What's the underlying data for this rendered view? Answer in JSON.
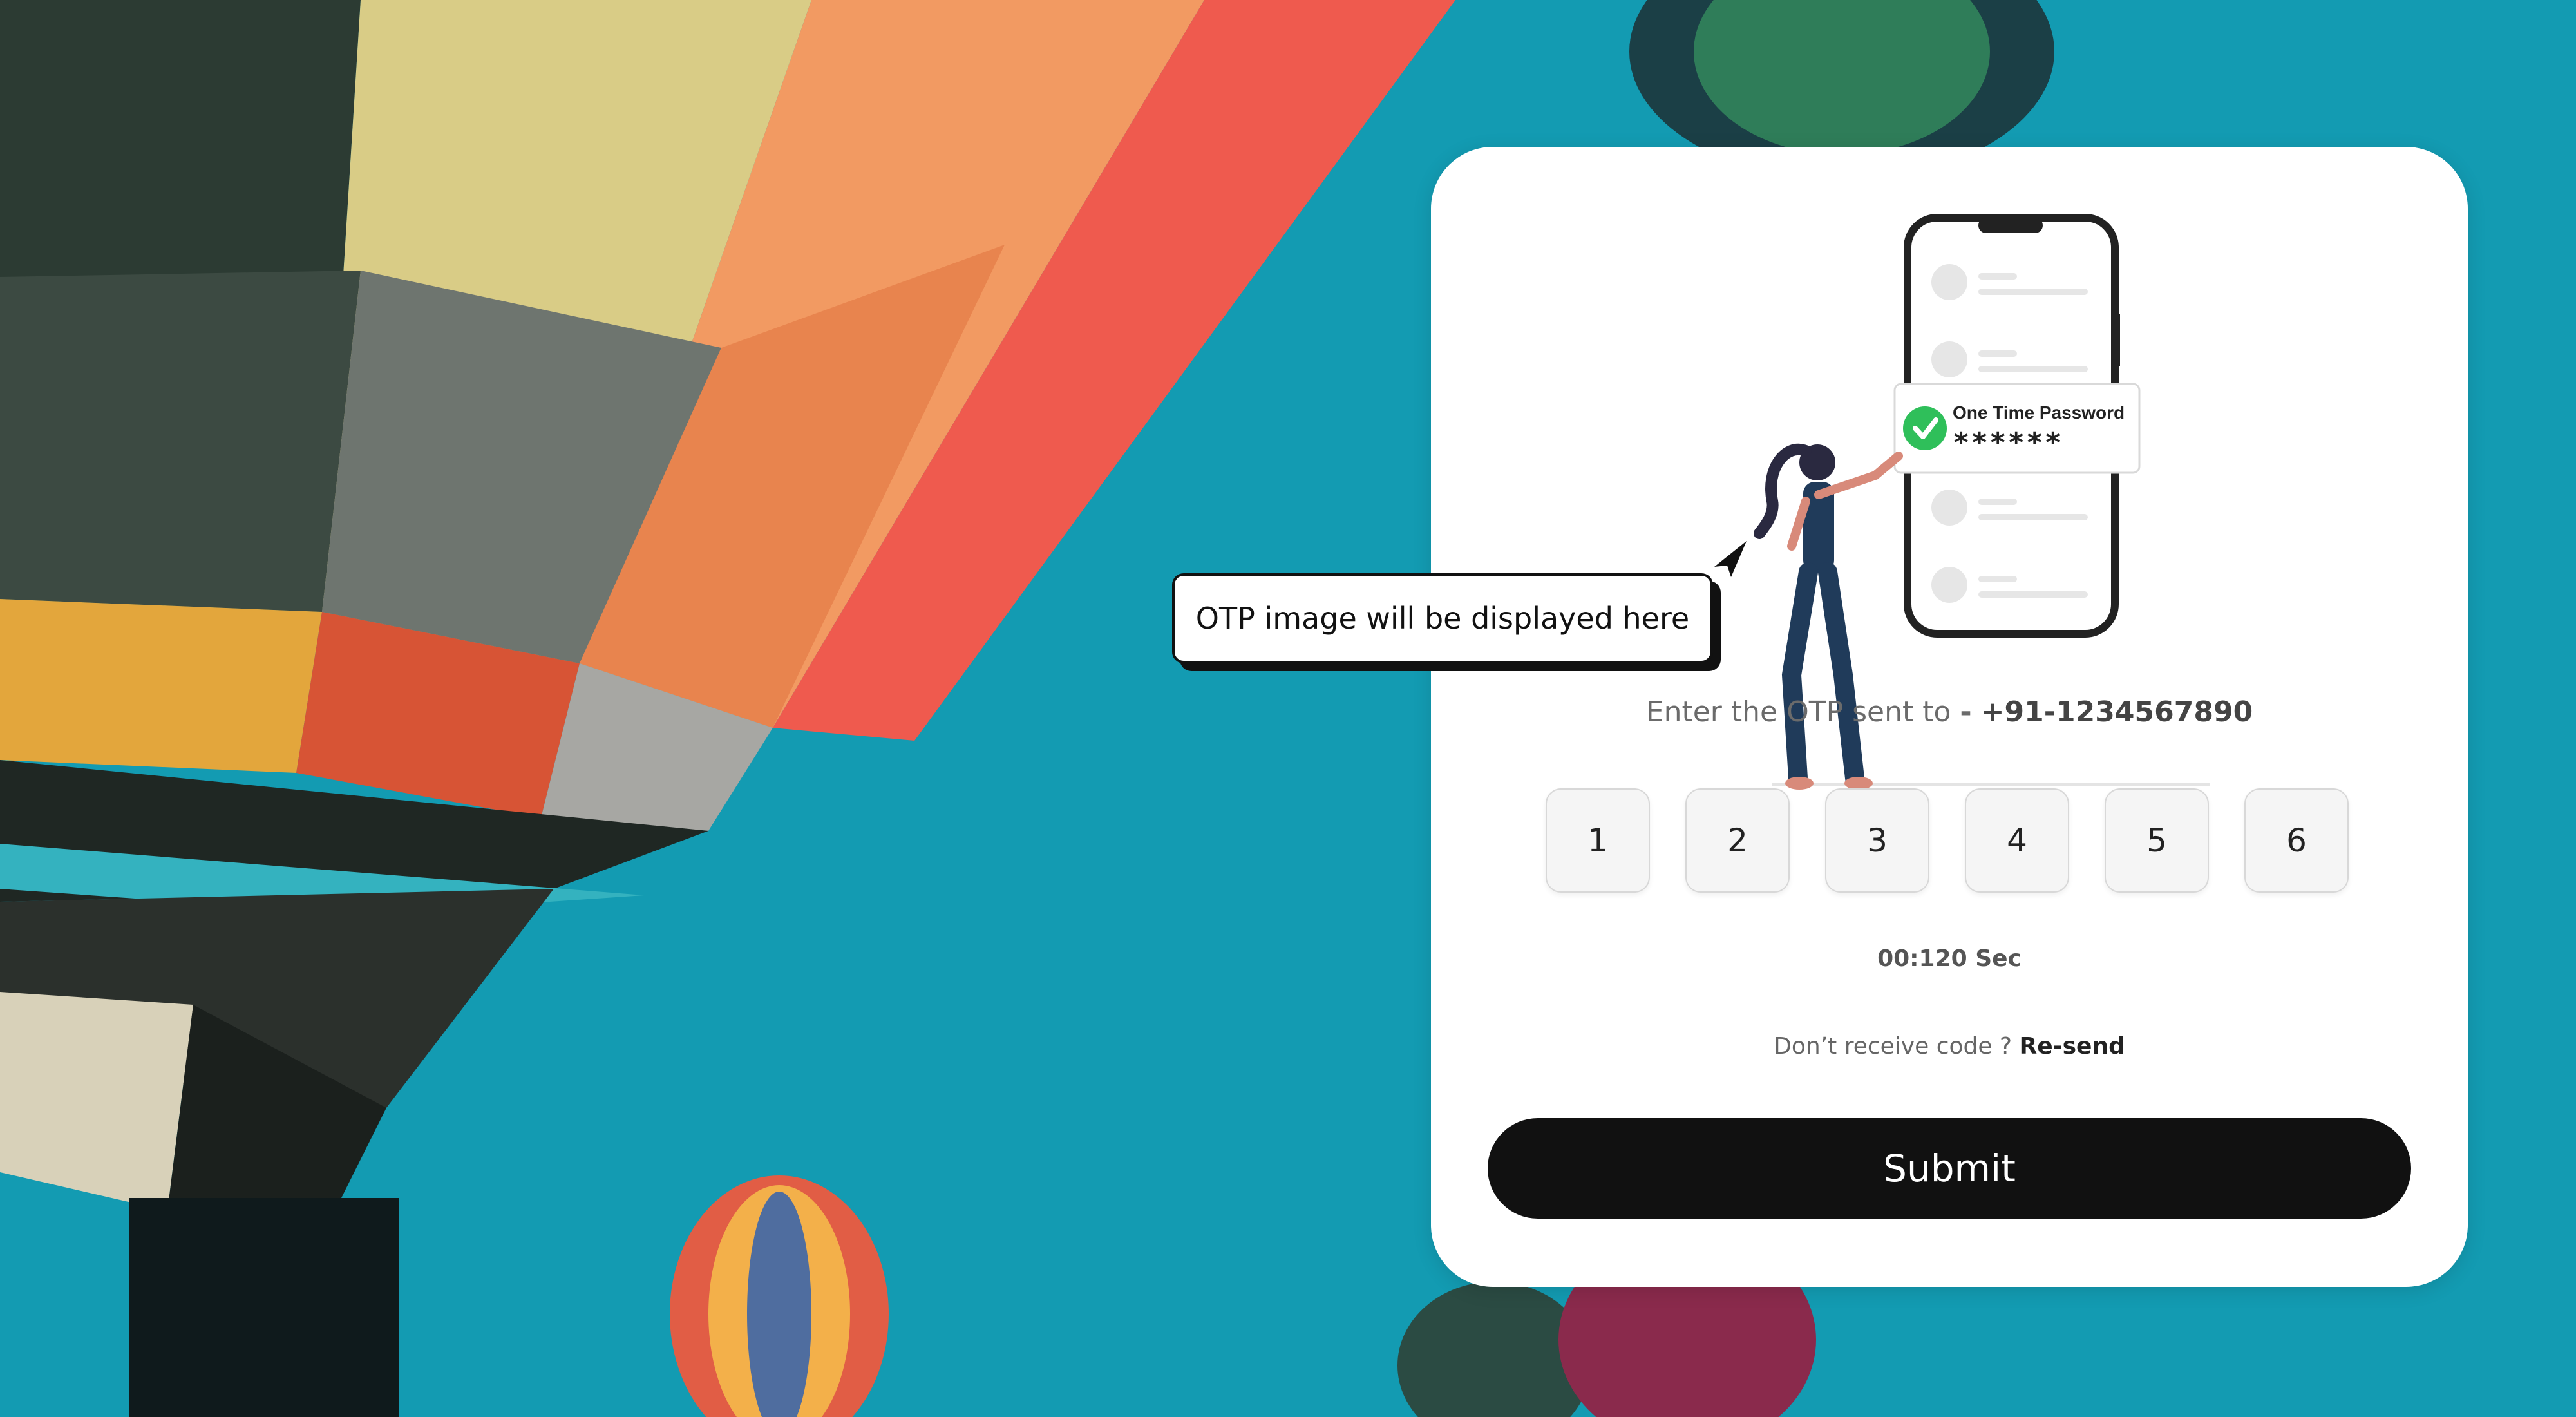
{
  "background": {
    "description_icon": "hot-air-balloon-photo",
    "sky_color": "#139bb2"
  },
  "otp_card": {
    "illustration": {
      "icon": "phone-otp-illustration",
      "popup_title": "One Time Password",
      "popup_masked": "******"
    },
    "prompt_text": "Enter the OTP sent to",
    "prompt_separator": "-",
    "phone_number": "+91-1234567890",
    "digits": [
      "1",
      "2",
      "3",
      "4",
      "5",
      "6"
    ],
    "timer": "00:120 Sec",
    "resend_prompt": "Don’t receive code ?",
    "resend_label": "Re-send",
    "submit_label": "Submit"
  },
  "callout": {
    "text": "OTP image will be displayed here"
  },
  "colors": {
    "primary": "#111111",
    "success": "#2fbf5a",
    "card": "#ffffff"
  }
}
